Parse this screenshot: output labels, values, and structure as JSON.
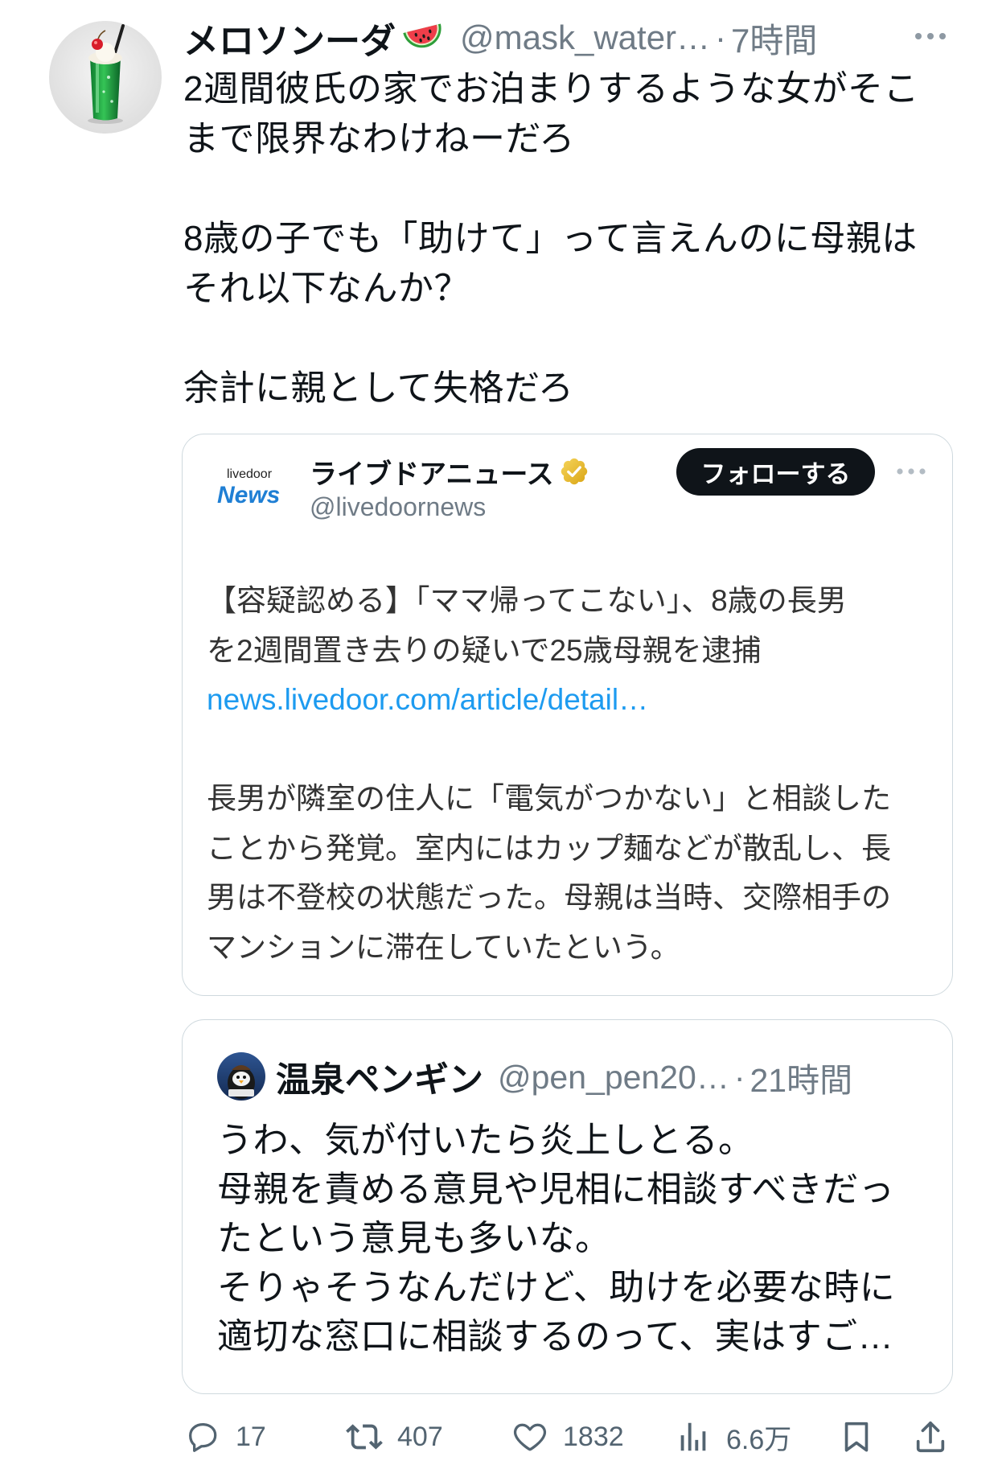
{
  "tweet": {
    "author": {
      "name": "メロソンーダ",
      "name_emoji_icon": "watermelon-icon",
      "avatar_icon": "cream-soda-avatar",
      "handle": "@mask_water…",
      "separator": "·",
      "time": "7時間"
    },
    "more_icon": "more-icon",
    "paragraphs": [
      [
        "2週間彼氏の家でお泊まりするような女がそこ",
        "まで限界なわけねーだろ"
      ],
      [
        "8歳の子でも「助けて」って言えんのに母親は",
        "それ以下なんか？"
      ],
      [
        "余計に親として失格だろ"
      ]
    ]
  },
  "embed": {
    "logo_small": "livedoor",
    "logo_big": "News",
    "name": "ライブドアニュース",
    "verified_icon": "verified-gold-badge-icon",
    "handle": "@livedoornews",
    "follow_label": "フォローする",
    "more_icon": "more-icon",
    "headline_lines": [
      "【容疑認める】「ママ帰ってこない」、8歳の長男",
      "を2週間置き去りの疑いで25歳母親を逮捕"
    ],
    "link": "news.livedoor.com/article/detail…",
    "body_lines": [
      "長男が隣室の住人に「電気がつかない」と相談した",
      "ことから発覚。室内にはカップ麺などが散乱し、長",
      "男は不登校の状態だった。母親は当時、交際相手の",
      "マンションに滞在していたという。"
    ]
  },
  "quote": {
    "avatar_icon": "penguin-avatar",
    "name": "温泉ペンギン",
    "handle": "@pen_pen20…",
    "separator": "·",
    "time": "21時間",
    "lines": [
      "うわ、気が付いたら炎上しとる。",
      "母親を責める意見や児相に相談すべきだっ",
      "たという意見も多いな。",
      "そりゃそうなんだけど、助けを必要な時に",
      "適切な窓口に相談するのって、実はすご…"
    ]
  },
  "actions": {
    "reply": {
      "icon": "reply-icon",
      "count": "17"
    },
    "retweet": {
      "icon": "retweet-icon",
      "count": "407"
    },
    "like": {
      "icon": "heart-icon",
      "count": "1832"
    },
    "views": {
      "icon": "views-icon",
      "count": "6.6万"
    },
    "bookmark": {
      "icon": "bookmark-icon"
    },
    "share": {
      "icon": "share-icon"
    }
  },
  "colors": {
    "text": "#0f1419",
    "secondary": "#6f7b86",
    "action_gray": "#536471",
    "link": "#1d9bf0",
    "border": "#cfd9de",
    "follow_bg": "#0f1419",
    "verified_gold": "#e8b923",
    "logo_blue": "#1f7fd4"
  }
}
